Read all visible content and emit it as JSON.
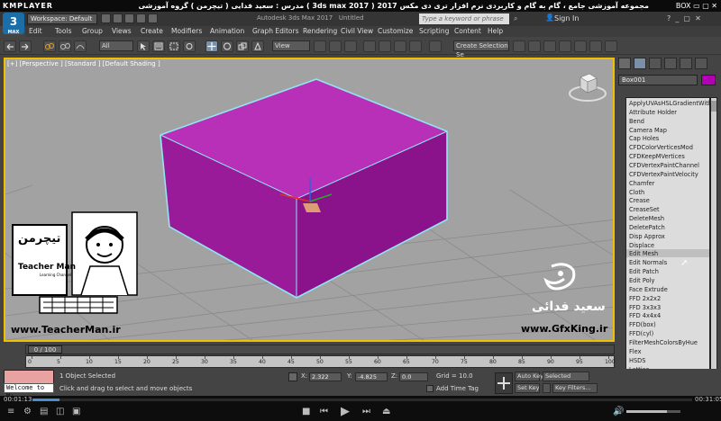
{
  "player": {
    "logo": "KMPLAYER",
    "title": "مجموعه آموزشی جامع ، گام به گام و کاربردی نرم افزار تری دی مکس 2017 ( 3ds max 2017 ) مدرس : سعید فدایی ( تیچرمن ) گروه آموزشی پادشاه گرافیست ها",
    "right_text": "BOX",
    "time_elapsed": "00:01:13",
    "time_total": "00:31:05"
  },
  "titlebar": {
    "app_logo": "3",
    "app_logo_sub": "MAX",
    "workspace": "Workspace: Default",
    "app_title": "Autodesk 3ds Max 2017",
    "doc_title": "Untitled",
    "search_placeholder": "Type a keyword or phrase",
    "signin": "Sign In"
  },
  "menu": [
    "Edit",
    "Tools",
    "Group",
    "Views",
    "Create",
    "Modifiers",
    "Animation",
    "Graph Editors",
    "Rendering",
    "Civil View",
    "Customize",
    "Scripting",
    "Content",
    "Help"
  ],
  "toolbar": {
    "filter": "All",
    "refcoord": "View",
    "selection_set": "Create Selection Se"
  },
  "viewport": {
    "label": "[+] [Perspective ] [Standard ] [Default Shading ]",
    "object_color": "#b400b4"
  },
  "command_panel": {
    "object_name": "Box001",
    "modifiers": [
      "ApplyUVAsHSLGradientWithMid",
      "Attribute Holder",
      "Bend",
      "Camera Map",
      "Cap Holes",
      "CFDColorVerticesMod",
      "CFDKeepMVertices",
      "CFDVertexPaintChannel",
      "CFDVertexPaintVelocity",
      "Chamfer",
      "Cloth",
      "Crease",
      "CreaseSet",
      "DeleteMesh",
      "DeletePatch",
      "Disp Approx",
      "Displace",
      "Edit Mesh",
      "Edit Normals",
      "Edit Patch",
      "Edit Poly",
      "Face Extrude",
      "FFD 2x2x2",
      "FFD 3x3x3",
      "FFD 4x4x4",
      "FFD(box)",
      "FFD(cyl)",
      "FilterMeshColorsByHue",
      "Flex",
      "HSDS",
      "Lattice",
      "Linked XForm"
    ],
    "highlighted_index": 17
  },
  "timeline": {
    "frame_counter": "0 / 100",
    "ticks": [
      "0",
      "5",
      "10",
      "15",
      "20",
      "25",
      "30",
      "35",
      "40",
      "45",
      "50",
      "55",
      "60",
      "65",
      "70",
      "75",
      "80",
      "85",
      "90",
      "95",
      "100"
    ]
  },
  "status": {
    "maxscript_text": "Welcome to M:",
    "selected": "1 Object Selected",
    "prompt": "Click and drag to select and move objects",
    "x_label": "X:",
    "x_value": "2.322",
    "y_label": "Y:",
    "y_value": "-4.825",
    "z_label": "Z:",
    "z_value": "0.0",
    "grid": "Grid = 10.0",
    "add_time_tag": "Add Time Tag",
    "auto_key": "Auto Key",
    "set_key": "Set Key",
    "selected_dd": "Selected",
    "key_filters": "Key Filters..."
  },
  "watermarks": {
    "teacher_logo_fa": "تیچرمن",
    "teacher_man": "Teacher Man",
    "teacher_sub": "Learning Channel",
    "teacher_url": "www.TeacherMan.ir",
    "name_fa": "سعید فدائی",
    "gfx_url": "www.GfxKing.ir"
  }
}
